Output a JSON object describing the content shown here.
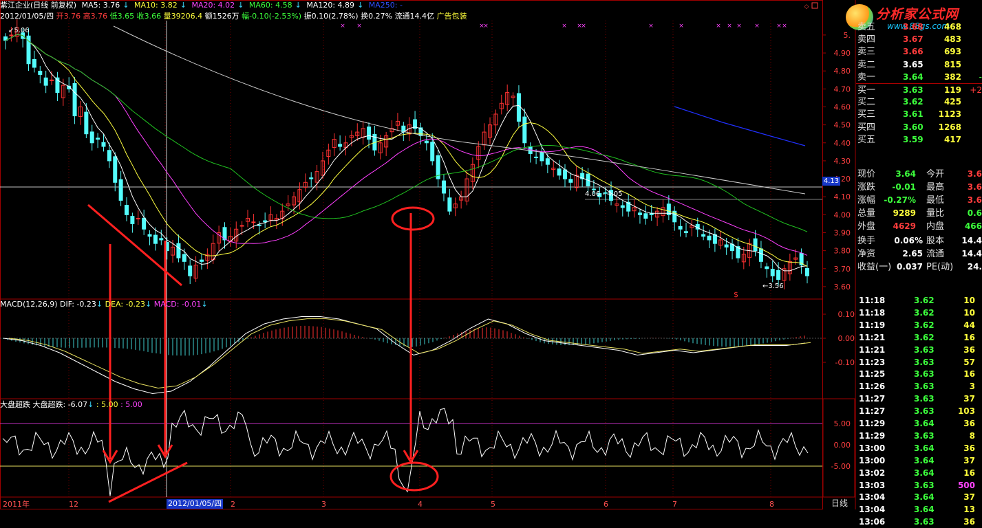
{
  "window": {
    "title": "紫江企业(日线 前复权)"
  },
  "ma_legend": {
    "ma5": "MA5: 3.76",
    "ma10": "MA10: 3.82",
    "ma20": "MA20: 4.02",
    "ma60": "MA60: 4.58",
    "ma120": "MA120: 4.89",
    "ma250": "MA250: -"
  },
  "quote_line": {
    "date": "2012/01/05/四",
    "open": "开3.76",
    "high": "高3.76",
    "low": "低3.65",
    "close": "收3.66",
    "vol": "量39206.4",
    "amount": "额1526万",
    "change": "幅-0.10(-2.53%)",
    "amp": "振0.10(2.78%)",
    "turn": "换0.27%",
    "float": "流通14.4亿",
    "ad": "广告包装"
  },
  "price_axis": [
    "5.",
    "4.90",
    "4.80",
    "4.70",
    "4.60",
    "4.50",
    "4.40",
    "4.30",
    "4.20",
    "4.10",
    "4.00",
    "3.90",
    "3.80",
    "3.70",
    "3.60"
  ],
  "price_marks": {
    "high_label": "5.06",
    "low_label": "3.56",
    "range_label": "4.06 - 4.05",
    "current_tag": "4.13"
  },
  "macd": {
    "title": "MACD(12,26,9)",
    "dif": "DIF: -0.23",
    "dea": "DEA: -0.23",
    "macd": "MACD: -0.01",
    "axis": [
      "0.10",
      "0.00",
      "-0.10"
    ]
  },
  "dpcd": {
    "title": "大盘超跌",
    "val1": "大盘超跌: -6.07",
    "val2": ": 5.00",
    "val3": ": 5.00",
    "axis": [
      "5.00",
      "0.00",
      "-5.00"
    ]
  },
  "x_axis": {
    "labels": [
      "2011年",
      "12",
      "2012/01/05/四",
      "2",
      "3",
      "4",
      "5",
      "6",
      "7",
      "8"
    ],
    "period": "日线"
  },
  "logo": {
    "text": "分析家公式网",
    "url": "www.88gs.com"
  },
  "order_book": [
    {
      "label": "卖五",
      "price": "3.68",
      "vol": "468"
    },
    {
      "label": "卖四",
      "price": "3.67",
      "vol": "483"
    },
    {
      "label": "卖三",
      "price": "3.66",
      "vol": "693"
    },
    {
      "label": "卖二",
      "price": "3.65",
      "vol": "815"
    },
    {
      "label": "卖一",
      "price": "3.64",
      "vol": "382",
      "extra": "-"
    },
    {
      "label": "买一",
      "price": "3.63",
      "vol": "119",
      "extra": "+2"
    },
    {
      "label": "买二",
      "price": "3.62",
      "vol": "425"
    },
    {
      "label": "买三",
      "price": "3.61",
      "vol": "1123"
    },
    {
      "label": "买四",
      "price": "3.60",
      "vol": "1268"
    },
    {
      "label": "买五",
      "price": "3.59",
      "vol": "417"
    }
  ],
  "stats": [
    {
      "l1": "现价",
      "v1": "3.64",
      "l2": "今开",
      "v2": "3.6"
    },
    {
      "l1": "涨跌",
      "v1": "-0.01",
      "l2": "最高",
      "v2": "3.6"
    },
    {
      "l1": "涨幅",
      "v1": "-0.27%",
      "l2": "最低",
      "v2": "3.6"
    },
    {
      "l1": "总量",
      "v1": "9289",
      "l2": "量比",
      "v2": "0.6"
    },
    {
      "l1": "外盘",
      "v1": "4629",
      "l2": "内盘",
      "v2": "466"
    }
  ],
  "stats2": [
    {
      "l1": "换手",
      "v1": "0.06%",
      "l2": "股本",
      "v2": "14.4"
    },
    {
      "l1": "净资",
      "v1": "2.65",
      "l2": "流通",
      "v2": "14.4"
    },
    {
      "l1": "收益(一)",
      "v1": "0.037",
      "l2": "PE(动)",
      "v2": "24."
    }
  ],
  "ticks": [
    {
      "t": "11:18",
      "p": "3.62",
      "v": "10"
    },
    {
      "t": "11:18",
      "p": "3.62",
      "v": "10"
    },
    {
      "t": "11:19",
      "p": "3.62",
      "v": "44"
    },
    {
      "t": "11:21",
      "p": "3.62",
      "v": "16"
    },
    {
      "t": "11:21",
      "p": "3.63",
      "v": "36"
    },
    {
      "t": "11:23",
      "p": "3.63",
      "v": "57"
    },
    {
      "t": "11:25",
      "p": "3.63",
      "v": "16"
    },
    {
      "t": "11:26",
      "p": "3.63",
      "v": "3"
    },
    {
      "t": "11:27",
      "p": "3.63",
      "v": "37"
    },
    {
      "t": "11:27",
      "p": "3.63",
      "v": "103"
    },
    {
      "t": "11:29",
      "p": "3.64",
      "v": "36"
    },
    {
      "t": "11:29",
      "p": "3.63",
      "v": "8"
    },
    {
      "t": "13:00",
      "p": "3.64",
      "v": "36"
    },
    {
      "t": "13:00",
      "p": "3.64",
      "v": "37"
    },
    {
      "t": "13:02",
      "p": "3.64",
      "v": "16"
    },
    {
      "t": "13:03",
      "p": "3.63",
      "v": "500"
    },
    {
      "t": "13:04",
      "p": "3.64",
      "v": "37"
    },
    {
      "t": "13:04",
      "p": "3.64",
      "v": "13"
    },
    {
      "t": "13:06",
      "p": "3.63",
      "v": "36"
    }
  ],
  "chart_data": {
    "type": "candlestick",
    "title": "紫江企业(日线 前复权)",
    "y_range": [
      3.55,
      5.08
    ],
    "closes": [
      4.97,
      5.0,
      5.04,
      4.98,
      4.84,
      4.82,
      4.78,
      4.72,
      4.75,
      4.68,
      4.72,
      4.7,
      4.55,
      4.6,
      4.45,
      4.4,
      4.42,
      4.38,
      4.3,
      4.18,
      4.08,
      4.0,
      3.95,
      3.98,
      3.92,
      3.88,
      3.84,
      3.86,
      3.8,
      3.82,
      3.76,
      3.74,
      3.66,
      3.72,
      3.74,
      3.78,
      3.84,
      3.9,
      3.86,
      3.88,
      3.92,
      3.94,
      3.98,
      3.96,
      3.94,
      3.96,
      4.0,
      3.98,
      4.02,
      4.06,
      4.1,
      4.14,
      4.18,
      4.2,
      4.24,
      4.3,
      4.36,
      4.42,
      4.38,
      4.4,
      4.44,
      4.46,
      4.48,
      4.42,
      4.36,
      4.4,
      4.44,
      4.48,
      4.52,
      4.46,
      4.5,
      4.48,
      4.44,
      4.4,
      4.3,
      4.2,
      4.12,
      4.02,
      4.06,
      4.1,
      4.2,
      4.28,
      4.38,
      4.46,
      4.5,
      4.56,
      4.62,
      4.68,
      4.66,
      4.52,
      4.4,
      4.34,
      4.32,
      4.3,
      4.28,
      4.26,
      4.22,
      4.2,
      4.18,
      4.22,
      4.2,
      4.16,
      4.14,
      4.1,
      4.12,
      4.08,
      4.06,
      4.04,
      4.02,
      4.04,
      4.0,
      3.98,
      4.0,
      4.02,
      4.04,
      4.0,
      3.96,
      3.92,
      3.9,
      3.94,
      3.92,
      3.88,
      3.86,
      3.84,
      3.86,
      3.82,
      3.8,
      3.76,
      3.78,
      3.84,
      3.8,
      3.74,
      3.7,
      3.66,
      3.64,
      3.7,
      3.74,
      3.76,
      3.72,
      3.66
    ],
    "macd_dif": [
      0.0,
      -0.01,
      -0.03,
      -0.06,
      -0.1,
      -0.14,
      -0.18,
      -0.21,
      -0.23,
      -0.22,
      -0.18,
      -0.12,
      -0.05,
      0.02,
      0.06,
      0.08,
      0.09,
      0.09,
      0.08,
      0.06,
      0.04,
      -0.02,
      -0.07,
      -0.05,
      -0.01,
      0.04,
      0.08,
      0.06,
      0.02,
      -0.01,
      -0.02,
      -0.03,
      -0.04,
      -0.05,
      -0.07,
      -0.06,
      -0.05,
      -0.06,
      -0.05,
      -0.04,
      -0.03,
      -0.03,
      -0.03,
      -0.02
    ],
    "osc_levels": [
      5.0,
      0.0,
      -5.0
    ],
    "osc_value": -6.07
  }
}
